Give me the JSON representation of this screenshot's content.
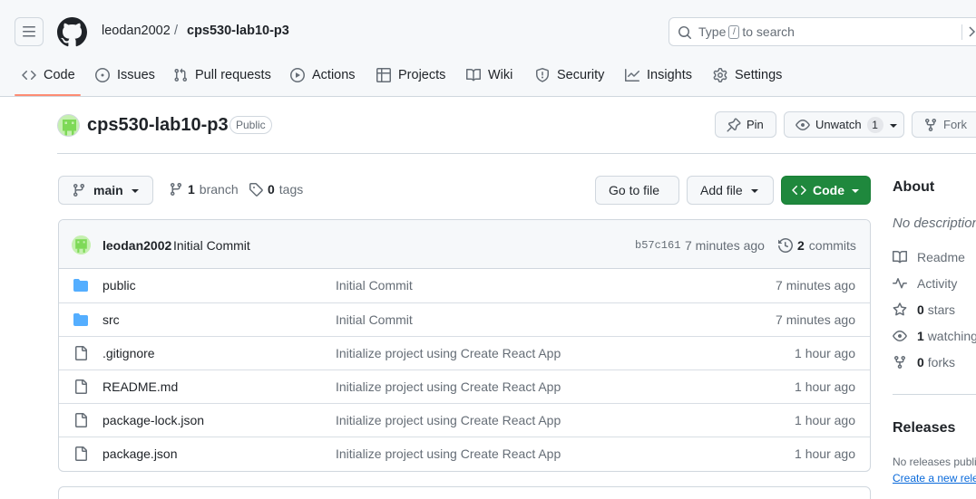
{
  "header": {
    "owner": "leodan2002",
    "separator": "/",
    "repo": "cps530-lab10-p3",
    "search": {
      "before": "Type",
      "key": "/",
      "after": "to search"
    }
  },
  "tabs": [
    {
      "label": "Code",
      "icon": "code-icon",
      "active": true
    },
    {
      "label": "Issues",
      "icon": "issue-icon"
    },
    {
      "label": "Pull requests",
      "icon": "pull-request-icon"
    },
    {
      "label": "Actions",
      "icon": "play-icon"
    },
    {
      "label": "Projects",
      "icon": "table-icon"
    },
    {
      "label": "Wiki",
      "icon": "book-icon"
    },
    {
      "label": "Security",
      "icon": "shield-icon"
    },
    {
      "label": "Insights",
      "icon": "graph-icon"
    },
    {
      "label": "Settings",
      "icon": "gear-icon"
    }
  ],
  "repo_header": {
    "name": "cps530-lab10-p3",
    "visibility": "Public",
    "pin_label": "Pin",
    "unwatch_label": "Unwatch",
    "watch_count": "1",
    "fork_label": "Fork"
  },
  "branch_bar": {
    "branch": "main",
    "branch_count": "1",
    "branch_word": "branch",
    "tag_count": "0",
    "tag_word": "tags",
    "go_to_file": "Go to file",
    "add_file": "Add file",
    "code": "Code"
  },
  "latest_commit": {
    "author": "leodan2002",
    "message": "Initial Commit",
    "sha": "b57c161",
    "time": "7 minutes ago",
    "count": "2",
    "count_word": "commits"
  },
  "files": [
    {
      "name": "public",
      "type": "dir",
      "message": "Initial Commit",
      "age": "7 minutes ago"
    },
    {
      "name": "src",
      "type": "dir",
      "message": "Initial Commit",
      "age": "7 minutes ago"
    },
    {
      "name": ".gitignore",
      "type": "file",
      "message": "Initialize project using Create React App",
      "age": "1 hour ago"
    },
    {
      "name": "README.md",
      "type": "file",
      "message": "Initialize project using Create React App",
      "age": "1 hour ago"
    },
    {
      "name": "package-lock.json",
      "type": "file",
      "message": "Initialize project using Create React App",
      "age": "1 hour ago"
    },
    {
      "name": "package.json",
      "type": "file",
      "message": "Initialize project using Create React App",
      "age": "1 hour ago"
    }
  ],
  "about": {
    "title": "About",
    "description": "No description",
    "readme": "Readme",
    "activity": "Activity",
    "stars_count": "0",
    "stars_word": "stars",
    "watching_count": "1",
    "watching_word": "watching",
    "forks_count": "0",
    "forks_word": "forks"
  },
  "releases": {
    "title": "Releases",
    "none": "No releases published",
    "create": "Create a new release"
  },
  "colors": {
    "accent_green": "#1f883d",
    "tab_underline": "#fd8c73",
    "folder_blue": "#54aeff",
    "link_blue": "#0969da"
  }
}
